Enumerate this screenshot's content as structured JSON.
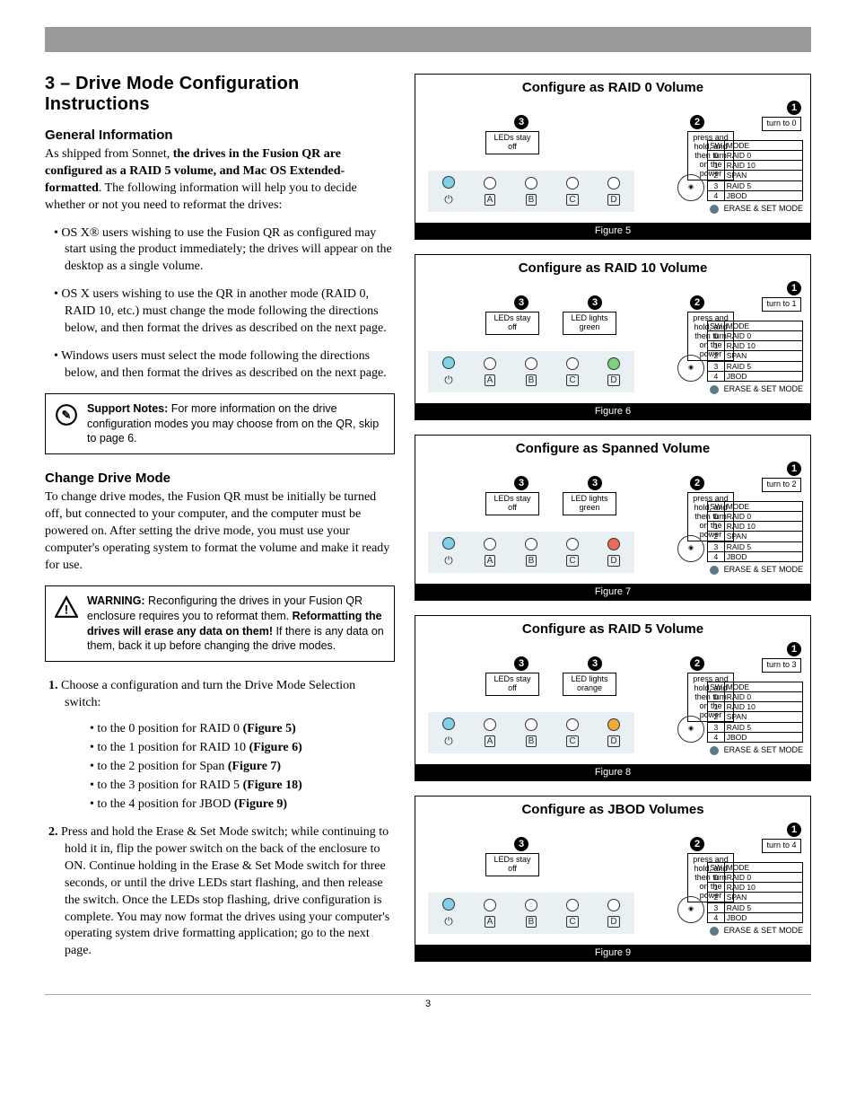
{
  "page_number": "3",
  "section_heading": "3 – Drive Mode Configuration Instructions",
  "general": {
    "heading": "General Information",
    "intro_a": "As shipped from Sonnet, ",
    "intro_bold": "the drives in the Fusion QR are configured as a RAID 5 volume, and Mac OS Extended-formatted",
    "intro_b": ". The following information will help you to decide whether or not you need to reformat the drives:",
    "bullets": [
      "OS X® users wishing to use the Fusion QR as configured may start using the product immediately; the drives will appear on the desktop as a single volume.",
      "OS X users wishing to use the QR in another mode (RAID 0, RAID 10, etc.) must change the mode following the directions below, and then format the drives as described on the next page.",
      "Windows users must select the mode following the directions below, and then format the drives as described on the next page."
    ]
  },
  "support_note": {
    "label": "Support Notes:",
    "text": " For more information on the drive configuration modes you may choose from on the QR, skip to page 6."
  },
  "change_mode": {
    "heading": "Change Drive Mode",
    "intro": "To change drive modes, the Fusion QR must be initially be turned off, but connected to your computer, and the computer must be powered on. After setting the drive mode, you must use your computer's operating system to format the volume and make it ready for use."
  },
  "warning": {
    "label": "WARNING:",
    "text_a": " Reconfiguring the drives in your Fusion QR enclosure requires you to reformat them. ",
    "bold": "Reformatting the drives will erase any data on them!",
    "text_b": " If there is any data on them, back it up before changing the drive modes."
  },
  "steps": {
    "s1_lead": "Choose a configuration and turn the Drive Mode Selection switch:",
    "s1_items": [
      {
        "pre": "to the 0 position for RAID 0 ",
        "bold": "(Figure 5)"
      },
      {
        "pre": "to the 1 position for RAID 10 ",
        "bold": "(Figure 6)"
      },
      {
        "pre": "to the 2 position for Span ",
        "bold": "(Figure 7)"
      },
      {
        "pre": "to the 3 position for RAID 5 ",
        "bold": "(Figure 18)"
      },
      {
        "pre": "to the 4 position for JBOD ",
        "bold": "(Figure 9)"
      }
    ],
    "s2": "Press and hold the Erase & Set Mode switch; while continuing to hold it in, flip the power switch on the back of the enclosure to ON. Continue holding in the Erase & Set Mode switch for three seconds, or until the drive LEDs start flashing, and then release the switch. Once the LEDs stop flashing, drive configuration is complete. You may now format the drives using your computer's operating system drive formatting application; go to the next page."
  },
  "mode_table": {
    "hdr_sw": "SW",
    "hdr_mode": "MODE",
    "rows": [
      {
        "sw": "0",
        "mode": "RAID 0"
      },
      {
        "sw": "1",
        "mode": "RAID 10"
      },
      {
        "sw": "2",
        "mode": "SPAN"
      },
      {
        "sw": "3",
        "mode": "RAID 5"
      },
      {
        "sw": "4",
        "mode": "JBOD"
      }
    ],
    "erase_label": "ERASE & SET MODE"
  },
  "press_text": "press and hold, and then turn on the power",
  "led_off_label": "LEDs stay off",
  "led_green_label": "LED lights green",
  "led_orange_label": "LED lights orange",
  "figures": [
    {
      "title": "Configure as RAID 0 Volume",
      "caption": "Figure 5",
      "turn": "turn to 0",
      "second_led": null,
      "led_d": "off"
    },
    {
      "title": "Configure as RAID 10 Volume",
      "caption": "Figure 6",
      "turn": "turn to 1",
      "second_led": "green",
      "led_d": "green"
    },
    {
      "title": "Configure as Spanned Volume",
      "caption": "Figure 7",
      "turn": "turn to 2",
      "second_led": "green",
      "led_d": "red"
    },
    {
      "title": "Configure as RAID 5 Volume",
      "caption": "Figure 8",
      "turn": "turn to 3",
      "second_led": "orange",
      "led_d": "orange"
    },
    {
      "title": "Configure as JBOD Volumes",
      "caption": "Figure 9",
      "turn": "turn to 4",
      "second_led": null,
      "led_d": "off"
    }
  ]
}
